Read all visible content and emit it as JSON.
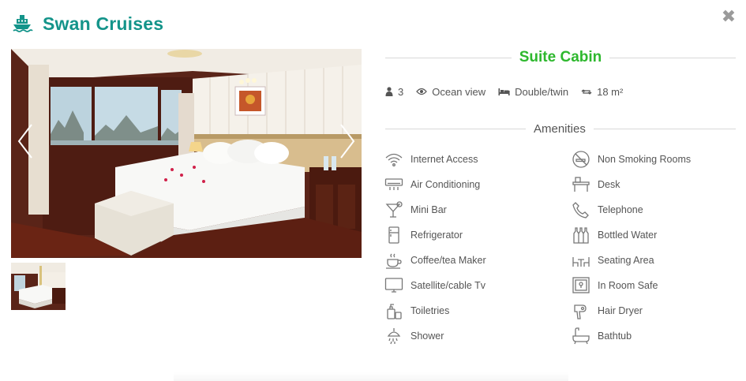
{
  "header": {
    "brand": "Swan Cruises",
    "brand_icon": "ship-icon",
    "brand_color": "#14948a"
  },
  "close": {
    "label": "✖",
    "icon": "close-icon"
  },
  "gallery": {
    "main_image": "cabin-bedroom-photo",
    "thumbnails": [
      "cabin-thumbnail-1"
    ]
  },
  "cabin": {
    "title": "Suite Cabin",
    "title_color": "#2eb82e"
  },
  "facts": {
    "occupancy": "3",
    "view": "Ocean view",
    "bed": "Double/twin",
    "size": "18 m²"
  },
  "amenities": {
    "heading": "Amenities",
    "items": [
      {
        "label": "Internet Access",
        "icon": "wifi-icon"
      },
      {
        "label": "Non Smoking Rooms",
        "icon": "no-smoking-icon"
      },
      {
        "label": "Air Conditioning",
        "icon": "air-conditioner-icon"
      },
      {
        "label": "Desk",
        "icon": "desk-icon"
      },
      {
        "label": "Mini Bar",
        "icon": "cocktail-icon"
      },
      {
        "label": "Telephone",
        "icon": "telephone-icon"
      },
      {
        "label": "Refrigerator",
        "icon": "refrigerator-icon"
      },
      {
        "label": "Bottled Water",
        "icon": "bottles-icon"
      },
      {
        "label": "Coffee/tea Maker",
        "icon": "coffee-cup-icon"
      },
      {
        "label": "Seating Area",
        "icon": "seating-icon"
      },
      {
        "label": "Satellite/cable Tv",
        "icon": "tv-icon"
      },
      {
        "label": "In Room Safe",
        "icon": "safe-icon"
      },
      {
        "label": "Toiletries",
        "icon": "toiletries-icon"
      },
      {
        "label": "Hair Dryer",
        "icon": "hair-dryer-icon"
      },
      {
        "label": "Shower",
        "icon": "shower-icon"
      },
      {
        "label": "Bathtub",
        "icon": "bathtub-icon"
      }
    ]
  }
}
